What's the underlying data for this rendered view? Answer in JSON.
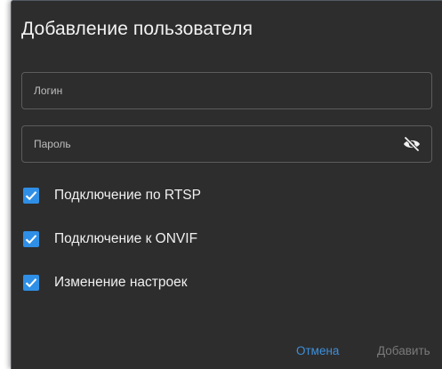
{
  "dialog": {
    "title": "Добавление пользователя",
    "login": {
      "placeholder": "Логин",
      "value": ""
    },
    "password": {
      "placeholder": "Пароль",
      "value": "",
      "toggle_icon": "eye-off-icon"
    },
    "checkboxes": [
      {
        "label": "Подключение по RTSP",
        "checked": true
      },
      {
        "label": "Подключение к ONVIF",
        "checked": true
      },
      {
        "label": "Изменение настроек",
        "checked": true
      }
    ],
    "buttons": {
      "cancel_label": "Отмена",
      "add_label": "Добавить"
    }
  },
  "colors": {
    "background": "#2d2d2d",
    "accent": "#2f8fe6",
    "link": "#3d8fdb",
    "disabled": "#7a7a7a"
  }
}
